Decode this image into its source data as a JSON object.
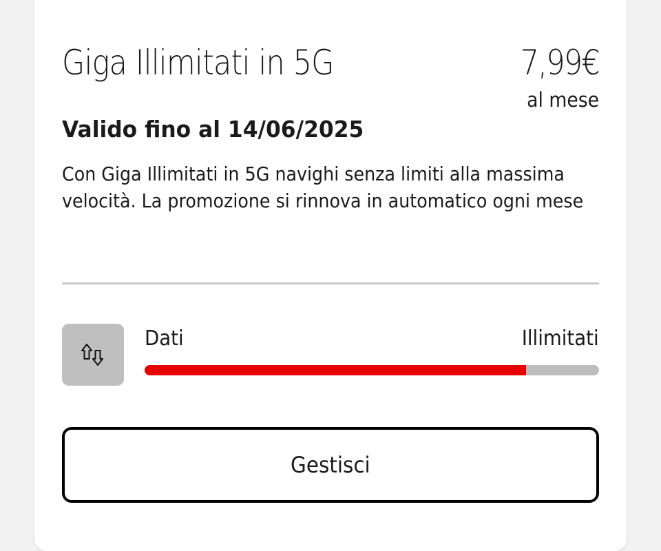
{
  "offer": {
    "title": "Giga Illimitati in 5G",
    "price": "7,99€",
    "period": "al mese",
    "validity": "Valido fino al 14/06/2025",
    "description": "Con Giga Illimitati in 5G navighi senza limiti alla massima velocità. La promozione si rinnova in automatico ogni mese"
  },
  "usage": {
    "icon": "data-transfer-arrows-icon",
    "label": "Dati",
    "value": "Illimitati",
    "progress_fraction": 0.84,
    "fill_color": "#e60000",
    "track_color": "#bdbdbd"
  },
  "actions": {
    "manage_label": "Gestisci"
  }
}
